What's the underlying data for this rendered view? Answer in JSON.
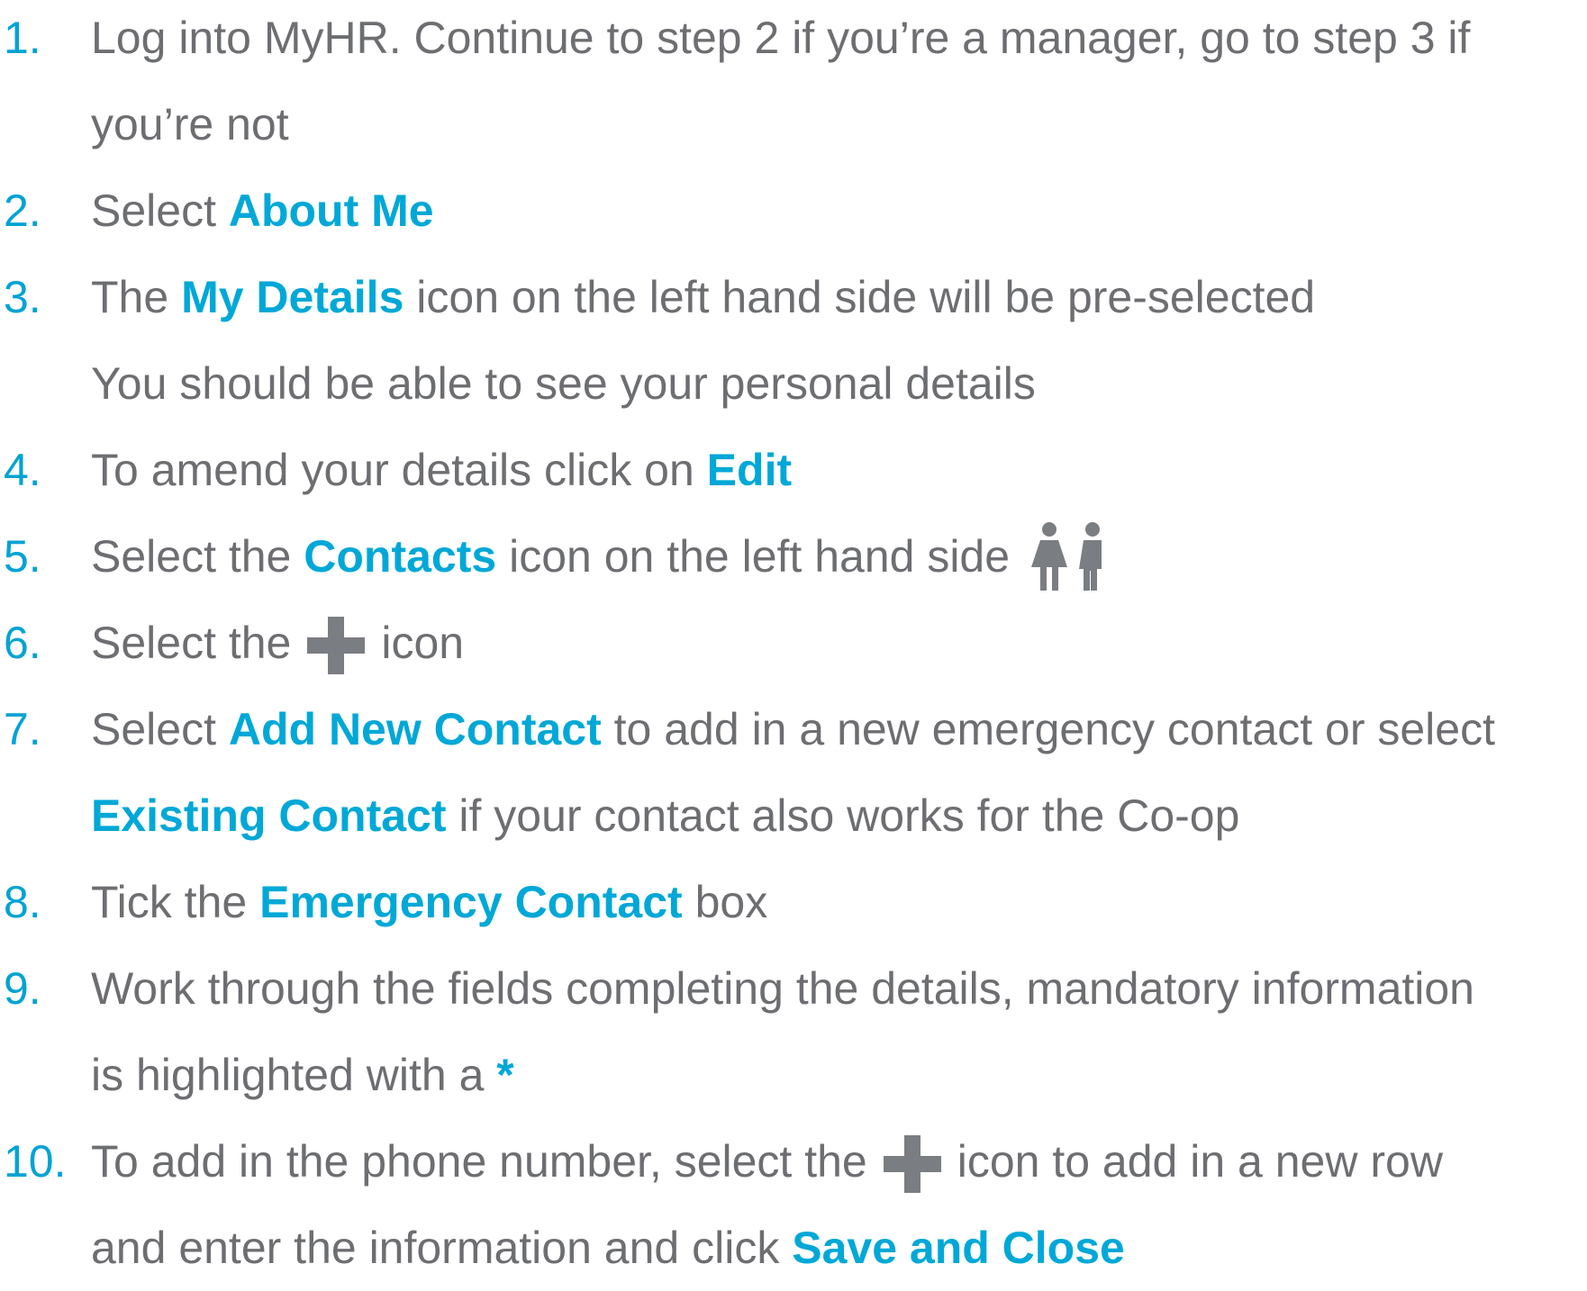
{
  "steps": [
    {
      "number": "1.",
      "lines": [
        {
          "t1": "Log into MyHR. Continue to step 2 if you’re a manager, go to step 3 if"
        },
        {
          "t1": "you’re not"
        }
      ]
    },
    {
      "number": "2.",
      "lines": [
        {
          "t1": "Select ",
          "hl": "About Me"
        }
      ]
    },
    {
      "number": "3.",
      "lines": [
        {
          "t1": "The ",
          "hl": "My Details",
          "t2": " icon on the left hand side will be pre-selected"
        },
        {
          "t1": "You should be able to see your personal details"
        }
      ]
    },
    {
      "number": "4.",
      "lines": [
        {
          "t1": "To amend your details click on ",
          "hl": "Edit"
        }
      ]
    },
    {
      "number": "5.",
      "lines": [
        {
          "t1": "Select the ",
          "hl": "Contacts",
          "t2": " icon on the left hand side",
          "icon": "contacts-icon"
        }
      ]
    },
    {
      "number": "6.",
      "lines": [
        {
          "t1": "Select the",
          "icon": "plus-icon",
          "t2": "icon"
        }
      ]
    },
    {
      "number": "7.",
      "lines": [
        {
          "t1": "Select ",
          "hl": "Add New Contact",
          "t2": " to add in a new emergency contact or select"
        },
        {
          "hl": "Existing Contact",
          "t2": " if your contact also works for the Co-op"
        }
      ]
    },
    {
      "number": "8.",
      "lines": [
        {
          "t1": "Tick the ",
          "hl": "Emergency Contact",
          "t2": " box"
        }
      ]
    },
    {
      "number": "9.",
      "lines": [
        {
          "t1": "Work through the fields completing the details, mandatory information"
        },
        {
          "t1": "is highlighted with a ",
          "hl": "*"
        }
      ]
    },
    {
      "number": "10.",
      "lines": [
        {
          "t1": "To add in the phone number, select the",
          "icon": "plus-icon",
          "t2": "icon to add in a new row"
        },
        {
          "t1": "and enter the information and click ",
          "hl": "Save and Close"
        }
      ]
    }
  ],
  "colors": {
    "text": "#6d6e71",
    "accent": "#00a8d7",
    "icon": "#7a7d82"
  }
}
